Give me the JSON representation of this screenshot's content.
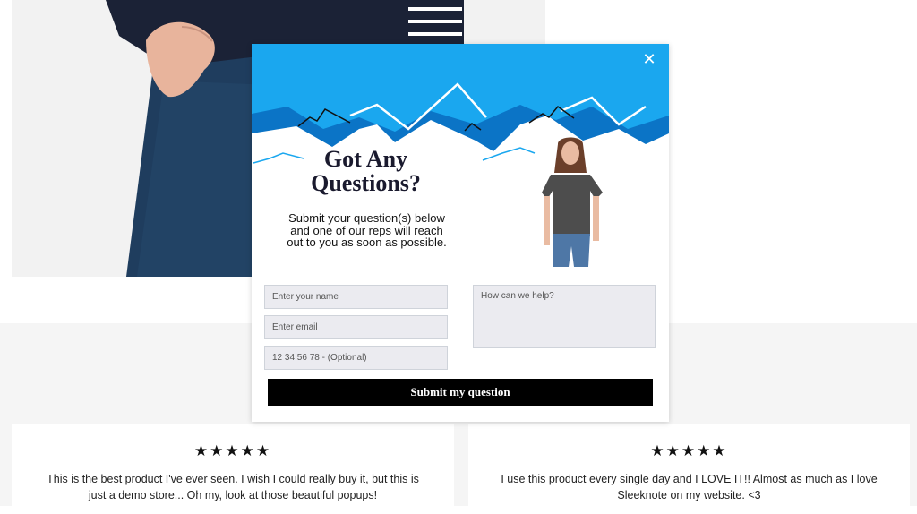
{
  "popup": {
    "close_icon": "close-icon",
    "headline_line1": "Got Any",
    "headline_line2": "Questions?",
    "subtext": "Submit your question(s) below and one of our reps will reach out to you as soon as possible.",
    "form": {
      "name_placeholder": "Enter your name",
      "email_placeholder": "Enter email",
      "phone_placeholder": "12 34 56 78 - (Optional)",
      "message_placeholder": "How can we help?",
      "submit_label": "Submit my question"
    },
    "colors": {
      "header_blue": "#1aa7ef",
      "dark_blue": "#0b74c6",
      "button": "#000000"
    }
  },
  "reviews": [
    {
      "stars": "★★★★★",
      "rating": 5,
      "text": "This is the best product I've ever seen. I wish I could really buy it, but this is just a demo store... Oh my, look at those beautiful popups!"
    },
    {
      "stars": "★★★★★",
      "rating": 5,
      "text": "I use this product every single day and I LOVE IT!! Almost as much as I love Sleeknote on my website. <3"
    }
  ]
}
